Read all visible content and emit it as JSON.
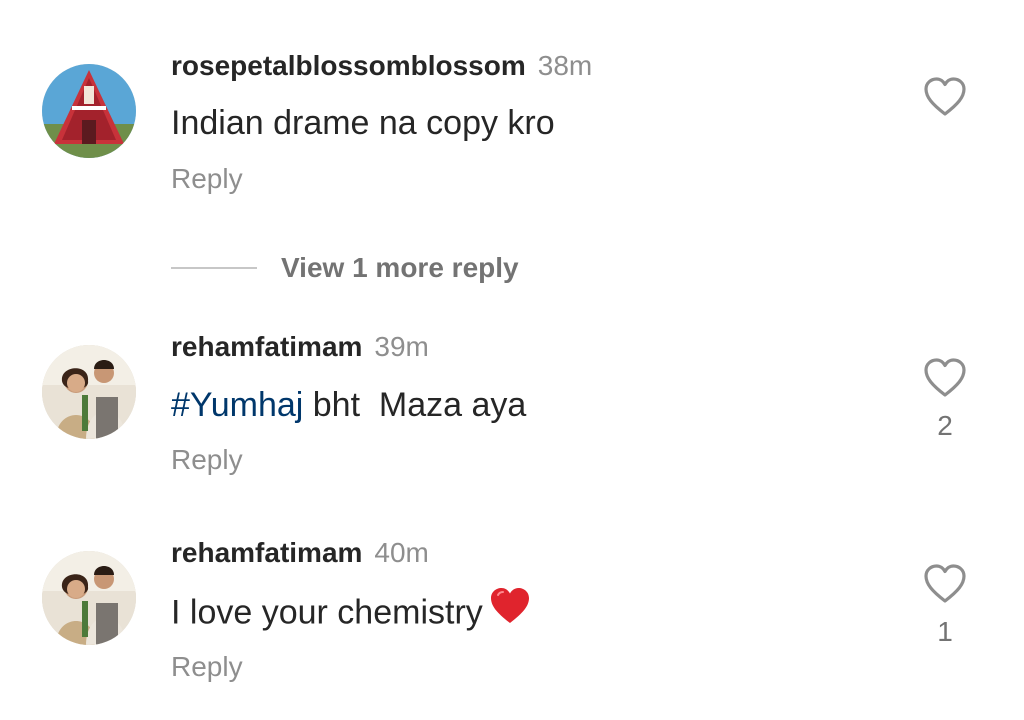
{
  "colors": {
    "text": "#262626",
    "muted": "#8e8e8e",
    "hashtag": "#00376b",
    "heart_emoji": "#e0242d",
    "divider": "#c7c7c7"
  },
  "comments": [
    {
      "username": "rosepetalblossomblossom",
      "time": "38m",
      "text": "Indian drame na copy kro",
      "reply_label": "Reply",
      "like_icon": "heart-outline-icon",
      "like_count": ""
    },
    {
      "username": "rehamfatimam",
      "time": "39m",
      "hashtag": "#Yumhaj",
      "text": " bht  Maza aya",
      "reply_label": "Reply",
      "like_icon": "heart-outline-icon",
      "like_count": "2"
    },
    {
      "username": "rehamfatimam",
      "time": "40m",
      "text": "I love your chemistry",
      "emoji": "red-heart-emoji",
      "reply_label": "Reply",
      "like_icon": "heart-outline-icon",
      "like_count": "1"
    }
  ],
  "view_more_replies": "View 1 more reply"
}
